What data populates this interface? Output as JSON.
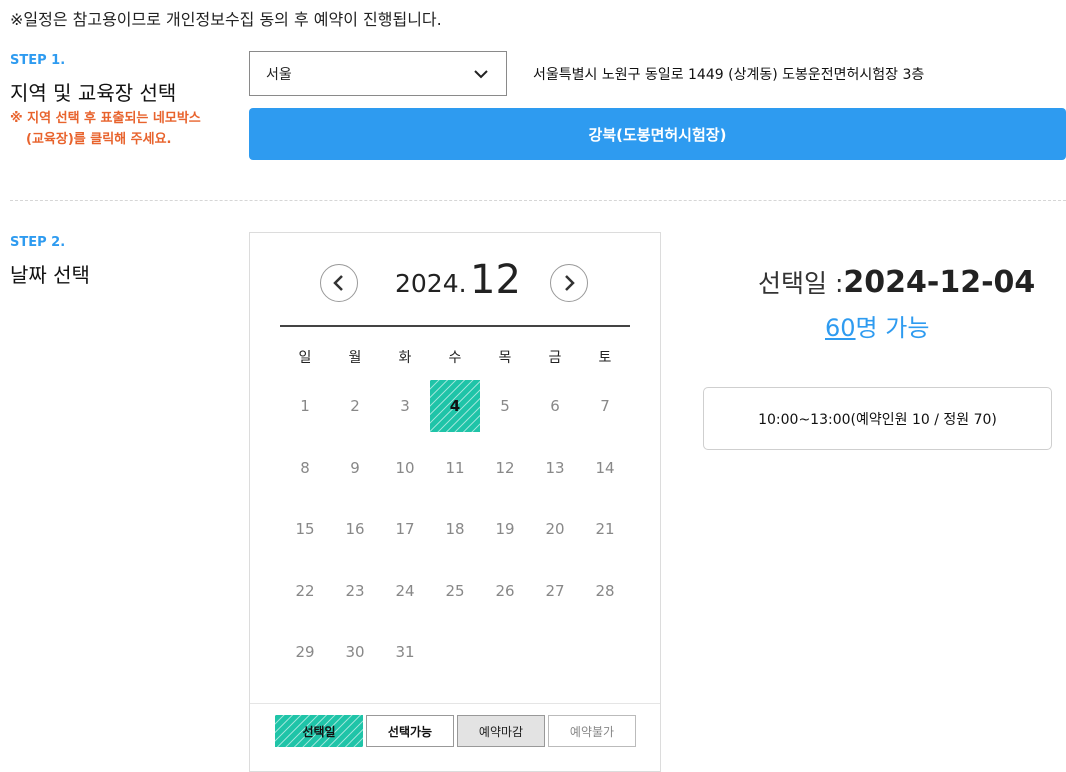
{
  "notice": "※일정은 참고용이므로 개인정보수집 동의 후 예약이 진행됩니다.",
  "step1": {
    "label": "STEP 1.",
    "title": "지역 및 교육장 선택",
    "hint_line1": "※ 지역 선택 후 표출되는 네모박스",
    "hint_line2": "(교육장)를 클릭해 주세요.",
    "region_value": "서울",
    "address": "서울특별시 노원구 동일로 1449 (상계동) 도봉운전면허시험장 3층",
    "center_button": "강북(도봉면허시험장)"
  },
  "step2": {
    "label": "STEP 2.",
    "title": "날짜 선택"
  },
  "calendar": {
    "year": "2024.",
    "month": "12",
    "weekdays": [
      "일",
      "월",
      "화",
      "수",
      "목",
      "금",
      "토"
    ],
    "weeks": [
      [
        "1",
        "2",
        "3",
        "4",
        "5",
        "6",
        "7"
      ],
      [
        "8",
        "9",
        "10",
        "11",
        "12",
        "13",
        "14"
      ],
      [
        "15",
        "16",
        "17",
        "18",
        "19",
        "20",
        "21"
      ],
      [
        "22",
        "23",
        "24",
        "25",
        "26",
        "27",
        "28"
      ],
      [
        "29",
        "30",
        "31",
        "",
        "",
        "",
        ""
      ]
    ],
    "selected_day": "4",
    "legend": {
      "selected": "선택일",
      "available": "선택가능",
      "closed": "예약마감",
      "unavailable": "예약불가"
    }
  },
  "selection": {
    "prefix": "선택일 :",
    "date": "2024-12-04",
    "count": "60",
    "count_suffix": "명 가능",
    "slot": "10:00~13:00(예약인원 10 / 정원 70)"
  },
  "colors": {
    "accent_blue": "#2e9bf0",
    "hint_orange": "#e8632d",
    "selected_teal": "#1fc4a8"
  }
}
